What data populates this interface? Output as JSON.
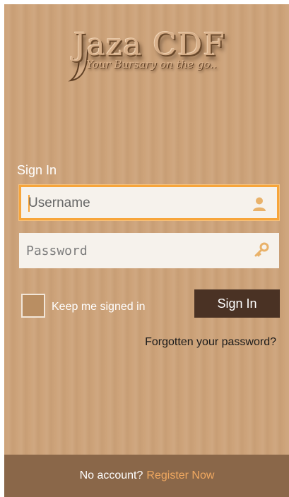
{
  "app": {
    "logo_title": "Jaza CDF",
    "logo_tagline": "Your Bursary on the go.."
  },
  "form": {
    "heading": "Sign In",
    "username": {
      "value": "",
      "placeholder": "Username",
      "icon": "person-icon"
    },
    "password": {
      "value": "",
      "placeholder": "Password",
      "icon": "key-icon"
    },
    "keep_signed_in": {
      "label": "Keep me signed in",
      "checked": false
    },
    "submit_label": "Sign In",
    "forgot_label": "Forgotten your password?"
  },
  "footer": {
    "prompt": "No account?",
    "register_label": "Register Now"
  },
  "colors": {
    "background": "#cda37a",
    "focus_border": "#f7a53a",
    "button": "#4a3224",
    "footer": "#8a6749",
    "link_accent": "#f0a860"
  }
}
